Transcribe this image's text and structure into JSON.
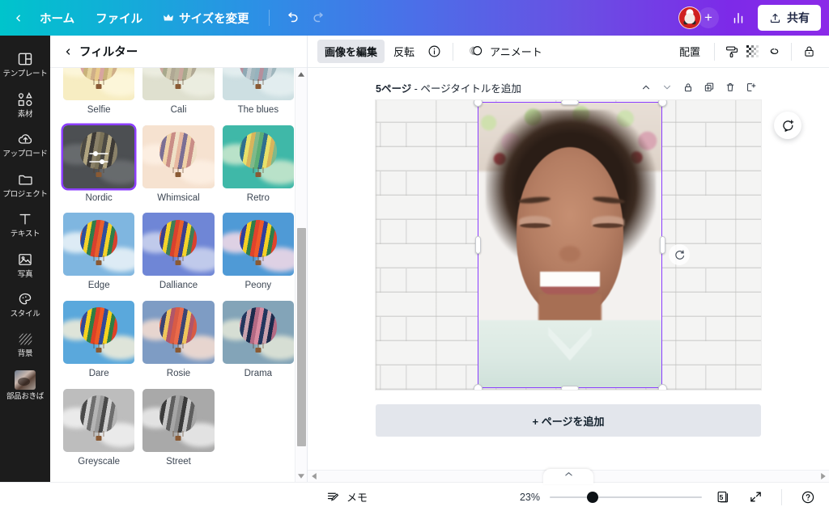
{
  "topbar": {
    "back_icon": "chevron-left-icon",
    "home_label": "ホーム",
    "file_label": "ファイル",
    "resize_label": "サイズを変更",
    "resize_icon": "crown-icon",
    "undo_icon": "undo-arrow-icon",
    "redo_icon": "redo-arrow-icon",
    "avatar_icon": "user-avatar",
    "add_member_label": "+",
    "stats_icon": "bar-chart-icon",
    "share_label": "共有",
    "share_icon": "upload-icon",
    "gradient_start": "#00c4cc",
    "gradient_end": "#8b2ae8"
  },
  "rail": {
    "items": [
      {
        "icon": "template-grid-icon",
        "label": "テンプレート"
      },
      {
        "icon": "shapes-icon",
        "label": "素材"
      },
      {
        "icon": "upload-cloud-icon",
        "label": "アップロード"
      },
      {
        "icon": "folder-icon",
        "label": "プロジェクト"
      },
      {
        "icon": "text-T-icon",
        "label": "テキスト"
      },
      {
        "icon": "photo-icon",
        "label": "写真"
      },
      {
        "icon": "palette-icon",
        "label": "スタイル"
      },
      {
        "icon": "hatch-pattern-icon",
        "label": "背景"
      },
      {
        "icon": "thumbnail-icon",
        "label": "部品おきば"
      }
    ]
  },
  "panel": {
    "back_icon": "chevron-left-icon",
    "title": "フィルター",
    "selected_filter": "Nordic",
    "selected_overlay_icon": "sliders-adjust-icon",
    "scrollbar": {
      "up_icon": "caret-up-icon",
      "down_icon": "caret-down-icon"
    },
    "filters": [
      {
        "name": "Selfie",
        "sky": "#f7edc2",
        "cloud": "#fdf7dd",
        "stripes": [
          "#e8c98a",
          "#d8a5a0",
          "#c9b27a",
          "#e5d39a",
          "#cfae88"
        ],
        "partial": true
      },
      {
        "name": "Cali",
        "sky": "#dfe0cf",
        "cloud": "#eeefe3",
        "stripes": [
          "#b9b59c",
          "#c9a79c",
          "#a8a98c",
          "#d2cbb0",
          "#b0a894"
        ],
        "partial": true
      },
      {
        "name": "The blues",
        "sky": "#cddfe2",
        "cloud": "#e6f0f1",
        "stripes": [
          "#96b3bd",
          "#b68f9c",
          "#8fa9b4",
          "#c1ccd2",
          "#9fb6bd"
        ],
        "partial": true
      },
      {
        "name": "Nordic",
        "sky": "#4c4f52",
        "cloud": "#6d7073",
        "stripes": [
          "#7a7258",
          "#4c4a44",
          "#b0a480",
          "#3d3a36",
          "#8a8169"
        ],
        "partial": false
      },
      {
        "name": "Whimsical",
        "sky": "#f6e2d0",
        "cloud": "#fdf0e4",
        "stripes": [
          "#e7b9a1",
          "#7b6f94",
          "#f0d2a8",
          "#c98d86",
          "#efe0c6"
        ],
        "partial": false
      },
      {
        "name": "Retro",
        "sky": "#3fb8a8",
        "cloud": "#cfe9cf",
        "stripes": [
          "#5cae76",
          "#2f6f8f",
          "#e8e06a",
          "#d8b45c",
          "#7fb98a"
        ],
        "partial": false
      },
      {
        "name": "Edge",
        "sky": "#7fb6e0",
        "cloud": "#eef5f8",
        "stripes": [
          "#e8602c",
          "#2e4f9e",
          "#f4d22a",
          "#2f7d4a",
          "#d9412e"
        ],
        "partial": false
      },
      {
        "name": "Dalliance",
        "sky": "#6f86d6",
        "cloud": "#cfd6ef",
        "stripes": [
          "#e8602c",
          "#3a3f8f",
          "#f4d22a",
          "#3f7d55",
          "#d9412e"
        ],
        "partial": false
      },
      {
        "name": "Peony",
        "sky": "#4f9ad6",
        "cloud": "#f7dbe7",
        "stripes": [
          "#ef5a28",
          "#2f3f9e",
          "#f5cf24",
          "#2f7d4a",
          "#e0432c"
        ],
        "partial": false
      },
      {
        "name": "Dare",
        "sky": "#5aa8dc",
        "cloud": "#f6efd9",
        "stripes": [
          "#ee5a24",
          "#314a99",
          "#f6d21f",
          "#2f7d45",
          "#df4126"
        ],
        "partial": false
      },
      {
        "name": "Rosie",
        "sky": "#7e9cc4",
        "cloud": "#f9e0d2",
        "stripes": [
          "#ea6a4a",
          "#3b4475",
          "#efc45c",
          "#b0566a",
          "#d85b45"
        ],
        "partial": false
      },
      {
        "name": "Drama",
        "sky": "#83a4b8",
        "cloud": "#e6e9d9",
        "stripes": [
          "#d98aa0",
          "#22365e",
          "#c9a2ae",
          "#1c2a4c",
          "#b36a84"
        ],
        "partial": false
      },
      {
        "name": "Greyscale",
        "sky": "#bdbdbd",
        "cloud": "#f2f2f2",
        "stripes": [
          "#9a9a9a",
          "#494949",
          "#cfcfcf",
          "#6e6e6e",
          "#b4b4b4"
        ],
        "partial": false
      },
      {
        "name": "Street",
        "sky": "#a9a9a9",
        "cloud": "#ededed",
        "stripes": [
          "#8d8d8d",
          "#3a3a3a",
          "#c4c4c4",
          "#5e5e5e",
          "#a5a5a5"
        ],
        "partial": false
      }
    ]
  },
  "edit_toolbar": {
    "edit_image_label": "画像を編集",
    "flip_label": "反転",
    "info_icon": "info-circle-icon",
    "animate_icon": "animate-circles-icon",
    "animate_label": "アニメート",
    "arrange_label": "配置",
    "paint_roller_icon": "paint-roller-icon",
    "transparency_icon": "checkerboard-transparency-icon",
    "link_icon": "link-chain-icon",
    "lock_icon": "lock-icon"
  },
  "page": {
    "title_prefix": "5ページ",
    "title_sep": " - ",
    "title_placeholder": "ページタイトルを追加",
    "tools": [
      {
        "icon": "chevron-up-icon",
        "name": "move-page-up"
      },
      {
        "icon": "chevron-down-icon",
        "name": "move-page-down"
      },
      {
        "icon": "lock-icon",
        "name": "lock-page"
      },
      {
        "icon": "duplicate-icon",
        "name": "duplicate-page"
      },
      {
        "icon": "trash-icon",
        "name": "delete-page"
      },
      {
        "icon": "add-page-icon",
        "name": "insert-page"
      }
    ],
    "selection_color": "#8b3dff",
    "rotate_icon": "rotate-icon",
    "comment_icon": "add-comment-icon",
    "add_page_label": "+ ページを追加"
  },
  "bottombar": {
    "memo_icon": "notes-icon",
    "memo_label": "メモ",
    "zoom_value": "23%",
    "page_count": "5",
    "grid_icon": "pages-grid-icon",
    "fullscreen_icon": "expand-arrows-icon",
    "help_icon": "question-circle-icon"
  },
  "scrollbars": {
    "left_arrow_icon": "caret-left-icon",
    "right_arrow_icon": "caret-right-icon",
    "collapse_icon": "chevron-up-icon"
  }
}
